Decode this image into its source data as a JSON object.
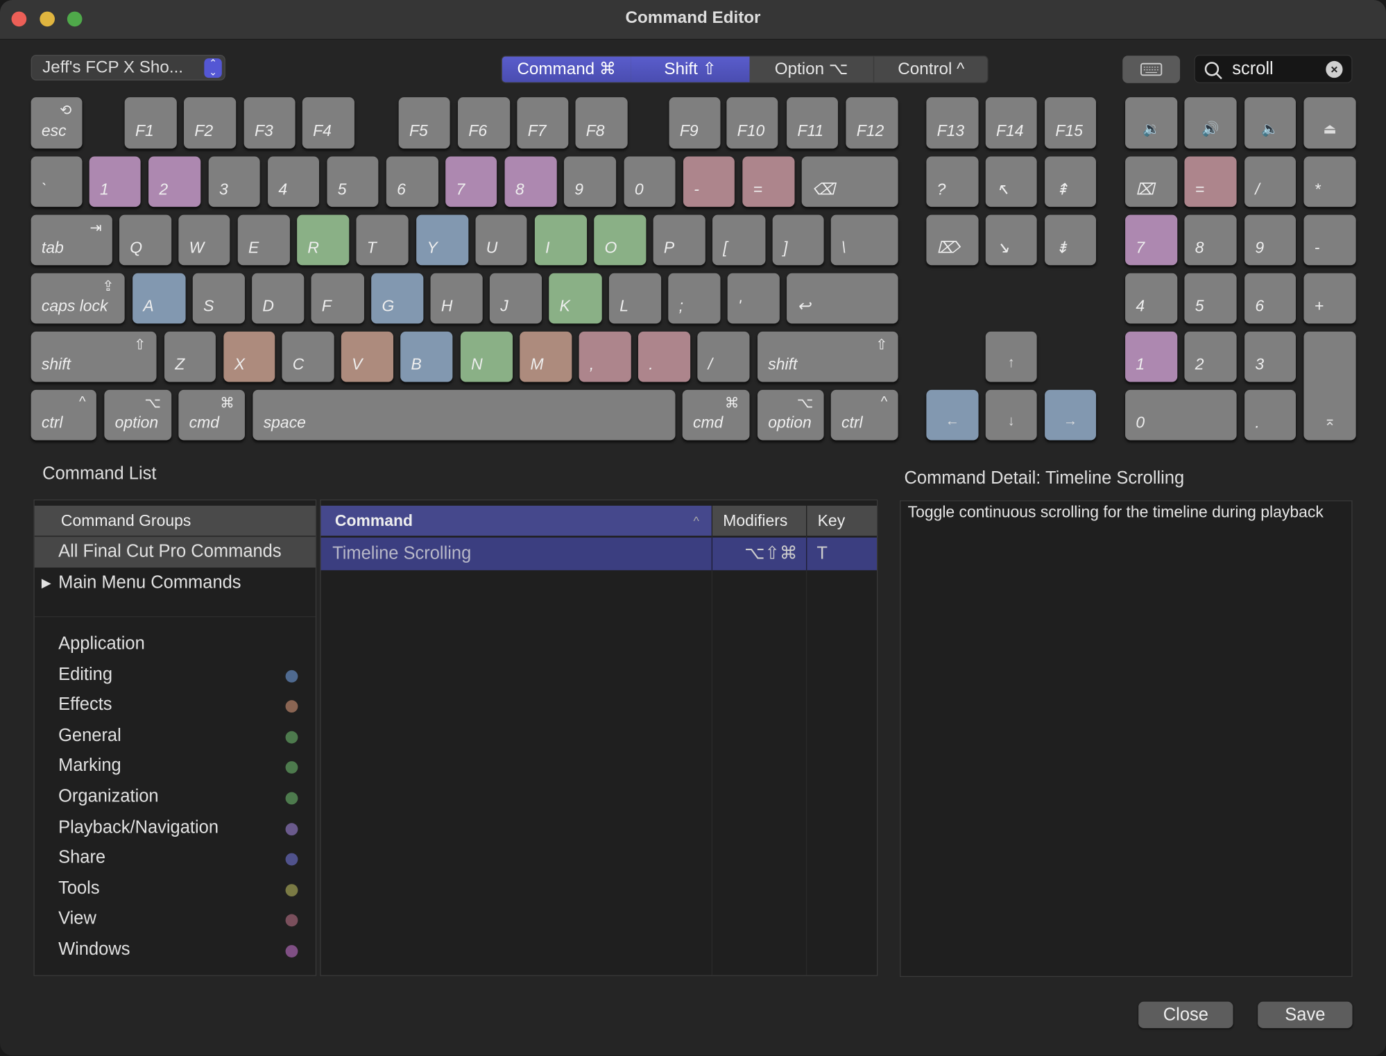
{
  "window": {
    "title": "Command Editor"
  },
  "toolbar": {
    "preset": "Jeff's FCP X Sho...",
    "modifiers": [
      {
        "label": "Command ⌘",
        "active": true
      },
      {
        "label": "Shift ⇧",
        "active": true
      },
      {
        "label": "Option ⌥",
        "active": false
      },
      {
        "label": "Control ^",
        "active": false
      }
    ],
    "search_value": "scroll"
  },
  "colors": {
    "purple": "#ad88b0",
    "pink": "#ad858c",
    "green": "#8ab086",
    "blue": "#8298b0",
    "brown": "#ad8b7d",
    "gray": "#7f7f7f",
    "accent": "#4f52b8"
  },
  "keyboard": {
    "keys": [
      {
        "l": "esc",
        "s": "⟲"
      },
      {
        "l": "F1"
      },
      {
        "l": "F2"
      },
      {
        "l": "F3"
      },
      {
        "l": "F4"
      },
      {
        "l": "F5"
      },
      {
        "l": "F6"
      },
      {
        "l": "F7"
      },
      {
        "l": "F8"
      },
      {
        "l": "F9"
      },
      {
        "l": "F10"
      },
      {
        "l": "F11"
      },
      {
        "l": "F12"
      },
      {
        "l": "F13"
      },
      {
        "l": "F14"
      },
      {
        "l": "F15"
      },
      {
        "c": "🔉"
      },
      {
        "c": "🔊"
      },
      {
        "c": "🔈"
      },
      {
        "c": "⏏"
      },
      {
        "l": "`"
      },
      {
        "l": "1",
        "k": "purple"
      },
      {
        "l": "2",
        "k": "purple"
      },
      {
        "l": "3"
      },
      {
        "l": "4"
      },
      {
        "l": "5"
      },
      {
        "l": "6"
      },
      {
        "l": "7",
        "k": "purple"
      },
      {
        "l": "8",
        "k": "purple"
      },
      {
        "l": "9"
      },
      {
        "l": "0"
      },
      {
        "l": "-",
        "k": "pink"
      },
      {
        "l": "=",
        "k": "pink"
      },
      {
        "l": "⌫"
      },
      {
        "l": "?"
      },
      {
        "l": "↖"
      },
      {
        "l": "⇞"
      },
      {
        "l": "⌧"
      },
      {
        "l": "=",
        "k": "pink"
      },
      {
        "l": "/"
      },
      {
        "l": "*"
      },
      {
        "l": "tab",
        "s": "⇥"
      },
      {
        "l": "Q"
      },
      {
        "l": "W"
      },
      {
        "l": "E"
      },
      {
        "l": "R",
        "k": "green"
      },
      {
        "l": "T"
      },
      {
        "l": "Y",
        "k": "blue"
      },
      {
        "l": "U"
      },
      {
        "l": "I",
        "k": "green"
      },
      {
        "l": "O",
        "k": "green"
      },
      {
        "l": "P"
      },
      {
        "l": "["
      },
      {
        "l": "]"
      },
      {
        "l": "\\"
      },
      {
        "l": "⌦"
      },
      {
        "l": "↘"
      },
      {
        "l": "⇟"
      },
      {
        "l": "7",
        "k": "purple"
      },
      {
        "l": "8"
      },
      {
        "l": "9"
      },
      {
        "l": "-"
      },
      {
        "l": "caps lock",
        "s": "⇪"
      },
      {
        "l": "A",
        "k": "blue"
      },
      {
        "l": "S"
      },
      {
        "l": "D"
      },
      {
        "l": "F"
      },
      {
        "l": "G",
        "k": "blue"
      },
      {
        "l": "H"
      },
      {
        "l": "J"
      },
      {
        "l": "K",
        "k": "green"
      },
      {
        "l": "L"
      },
      {
        "l": ";"
      },
      {
        "l": "'"
      },
      {
        "l": "↩"
      },
      {
        "l": "4"
      },
      {
        "l": "5"
      },
      {
        "l": "6"
      },
      {
        "l": "+"
      },
      {
        "l": "shift",
        "s": "⇧"
      },
      {
        "l": "Z"
      },
      {
        "l": "X",
        "k": "brown"
      },
      {
        "l": "C"
      },
      {
        "l": "V",
        "k": "brown"
      },
      {
        "l": "B",
        "k": "blue"
      },
      {
        "l": "N",
        "k": "green"
      },
      {
        "l": "M",
        "k": "brown"
      },
      {
        "l": ",",
        "k": "pink"
      },
      {
        "l": ".",
        "k": "pink"
      },
      {
        "l": "/"
      },
      {
        "l": "shift",
        "s": "⇧"
      },
      {
        "c": "↑"
      },
      {
        "l": "1",
        "k": "purple"
      },
      {
        "l": "2"
      },
      {
        "l": "3"
      },
      {
        "c": "⌅"
      },
      {
        "l": "ctrl",
        "s": "^"
      },
      {
        "l": "option",
        "s": "⌥"
      },
      {
        "l": "cmd",
        "s": "⌘"
      },
      {
        "l": "space"
      },
      {
        "l": "cmd",
        "s": "⌘"
      },
      {
        "l": "option",
        "s": "⌥"
      },
      {
        "l": "ctrl",
        "s": "^"
      },
      {
        "c": "←",
        "k": "blue"
      },
      {
        "c": "↓"
      },
      {
        "c": "→",
        "k": "blue"
      },
      {
        "l": "0"
      },
      {
        "l": "."
      }
    ]
  },
  "command_list": {
    "title": "Command List",
    "groups_header": "Command Groups",
    "all": "All Final Cut Pro Commands",
    "main_menu": "Main Menu Commands",
    "groups": [
      {
        "name": "Application",
        "dot": ""
      },
      {
        "name": "Editing",
        "dot": "#4f6a90"
      },
      {
        "name": "Effects",
        "dot": "#8a6553"
      },
      {
        "name": "General",
        "dot": "#4d7a4d"
      },
      {
        "name": "Marking",
        "dot": "#4d7a4d"
      },
      {
        "name": "Organization",
        "dot": "#4d7a4d"
      },
      {
        "name": "Playback/Navigation",
        "dot": "#6a5a8c"
      },
      {
        "name": "Share",
        "dot": "#50528c"
      },
      {
        "name": "Tools",
        "dot": "#7a7a44"
      },
      {
        "name": "View",
        "dot": "#7a4f5c"
      },
      {
        "name": "Windows",
        "dot": "#7f4f84"
      }
    ],
    "columns": {
      "command": "Command",
      "modifiers": "Modifiers",
      "key": "Key"
    },
    "rows": [
      {
        "command": "Timeline Scrolling",
        "modifiers": "⌥⇧⌘",
        "key": "T"
      }
    ]
  },
  "detail": {
    "title": "Command Detail: Timeline Scrolling",
    "text": "Toggle continuous scrolling for the timeline during playback"
  },
  "buttons": {
    "close": "Close",
    "save": "Save"
  }
}
